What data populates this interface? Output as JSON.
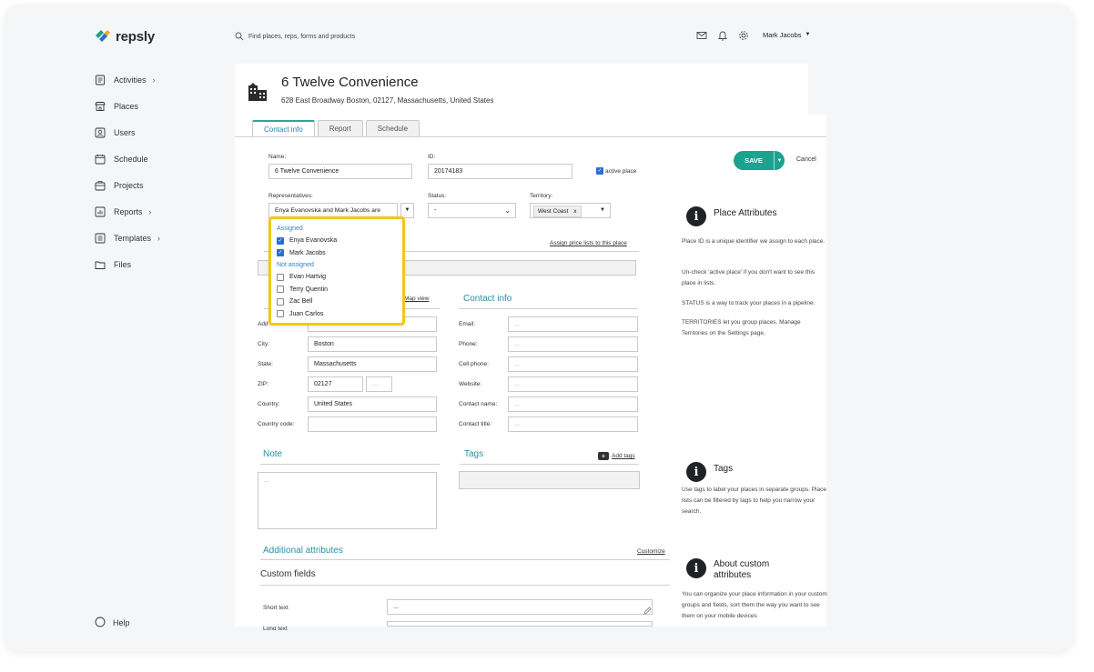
{
  "app": {
    "name": "repsly"
  },
  "sidebar": {
    "items": [
      {
        "label": "Activities",
        "icon": "activities-icon",
        "chevron": true
      },
      {
        "label": "Places",
        "icon": "store-icon",
        "chevron": false
      },
      {
        "label": "Users",
        "icon": "user-icon",
        "chevron": false
      },
      {
        "label": "Schedule",
        "icon": "calendar-icon",
        "chevron": false
      },
      {
        "label": "Projects",
        "icon": "projects-icon",
        "chevron": false
      },
      {
        "label": "Reports",
        "icon": "chart-icon",
        "chevron": true
      },
      {
        "label": "Templates",
        "icon": "templates-icon",
        "chevron": true
      },
      {
        "label": "Files",
        "icon": "folder-icon",
        "chevron": false
      }
    ],
    "help": "Help"
  },
  "header": {
    "search_placeholder": "Find places, reps, forms and products",
    "user_name": "Mark Jacobs"
  },
  "place": {
    "title": "6 Twelve Convenience",
    "address": "628 East Broadway Boston, 02127, Massachusetts, United States"
  },
  "tabs": [
    "Contact info",
    "Report",
    "Schedule"
  ],
  "form": {
    "name_label": "Name:",
    "name_value": "6 Twelve Convenience",
    "id_label": "ID:",
    "id_value": "20174183",
    "active_label": "active place",
    "reps_label": "Representatives:",
    "reps_value": "Enya Evanovska and Mark Jacobs are",
    "status_label": "Status:",
    "status_value": "-",
    "territory_label": "Territory:",
    "territory_value": "West Coast",
    "territory_remove": "x",
    "save": "SAVE",
    "cancel": "Cancel",
    "price_link": "Assign price lists to this place",
    "map_view": "Map view",
    "address": {
      "addr_label": "Add",
      "city_label": "City:",
      "city_value": "Boston",
      "state_label": "State:",
      "state_value": "Massachusetts",
      "zip_label": "ZIP:",
      "zip_value": "02127",
      "zip_ext": "...",
      "country_label": "Country:",
      "country_value": "United States",
      "country_code_label": "Country code:"
    },
    "contact": {
      "title": "Contact info",
      "email_label": "Email:",
      "phone_label": "Phone:",
      "cell_label": "Cell phone:",
      "website_label": "Website:",
      "contact_name_label": "Contact name:",
      "contact_title_label": "Contact title:",
      "placeholder": "..."
    },
    "note_title": "Note",
    "note_placeholder": "...",
    "tags_title": "Tags",
    "add_tags": "Add tags",
    "additional_title": "Additional attributes",
    "customize": "Customize",
    "custom_fields": "Custom fields",
    "short_text_label": "Short text",
    "short_text_value": "...",
    "long_text_label": "Long text"
  },
  "dropdown": {
    "assigned_label": "Assigned",
    "assigned": [
      "Enya Evanovska",
      "Mark Jacobs"
    ],
    "not_assigned_label": "Not assigned",
    "not_assigned": [
      "Evan Hartvig",
      "Terry Quentin",
      "Zac Bell",
      "Juan Carlos"
    ]
  },
  "help_panels": {
    "place_attributes": {
      "title": "Place Attributes",
      "lines": [
        "Place ID is a unique identifier we assign to each place.",
        "Un-check 'active place' if you don't want to see this place in lists.",
        "STATUS is a way to track your places in a pipeline.",
        "TERRITORIES let you group places. Manage Territories on the Settings page."
      ]
    },
    "tags": {
      "title": "Tags",
      "text": "Use tags to label your places in separate groups. Place lists can be filtered by tags to help you narrow your search."
    },
    "custom": {
      "title_1": "About custom",
      "title_2": "attributes",
      "text": "You can organize your place information in your custom groups and fields, sort them the way you want to see them on your mobile devices"
    }
  },
  "colors": {
    "accent": "#1aa38f",
    "link": "#2a7fd4",
    "highlight": "#f5c518",
    "section": "#2a8fa3"
  }
}
